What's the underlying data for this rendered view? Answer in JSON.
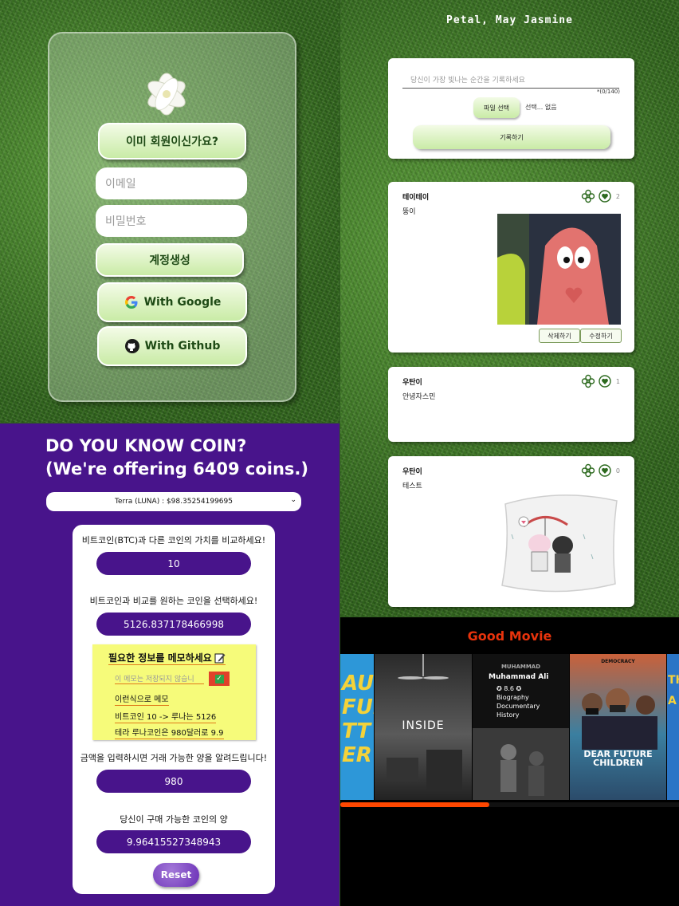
{
  "login": {
    "already_member_label": "이미 회원이신가요?",
    "email_placeholder": "이메일",
    "password_placeholder": "비밀번호",
    "create_account_label": "계정생성",
    "google_label": "With Google",
    "github_label": "With Github"
  },
  "feed": {
    "title": "Petal, May Jasmine",
    "composer": {
      "placeholder": "당신이 가장 빛나는 순간을 기록하세요",
      "char_count": "*(0/140)",
      "file_button": "파일 선택",
      "file_status": "선택... 없음",
      "submit_label": "기록하기"
    },
    "posts": [
      {
        "author": "테이테이",
        "text": "뚱이",
        "count": "2",
        "delete_label": "삭제하기",
        "edit_label": "수정하기"
      },
      {
        "author": "우탄이",
        "text": "안녕자스민",
        "count": "1"
      },
      {
        "author": "우탄이",
        "text": "테스트",
        "count": "0"
      }
    ]
  },
  "coin": {
    "title_line1": "DO YOU KNOW COIN?",
    "title_line2": "(We're offering 6409 coins.)",
    "selected_coin": "Terra (LUNA) : $98.35254199695",
    "compare_label": "비트코인(BTC)과 다른 코인의 가치를 비교하세요!",
    "btc_amount": "10",
    "select_label": "비트코인과 비교를 원하는 코인을 선택하세요!",
    "converted_value": "5126.837178466998",
    "memo": {
      "title": "필요한 정보를 메모하세요",
      "input_placeholder": "이 메모는 저장되지 않습니",
      "items": [
        "이런식으로 메모",
        "비트코인 10 -> 루나는 5126",
        "테라 루나코인은 980달러로 9.9"
      ]
    },
    "amount_label": "금액을 입력하시면 거래 가능한 양을 알려드립니다!",
    "amount_value": "980",
    "buyable_label": "당신이 구매 가능한 코인의 양",
    "buyable_value": "9.96415527348943",
    "reset_label": "Reset"
  },
  "movies": {
    "title": "Good Movie",
    "posters": [
      {
        "lines": [
          "AU",
          "FUL",
          "TT",
          "ER"
        ]
      },
      {
        "lines": [
          "INSIDE"
        ]
      },
      {
        "lines": [
          "MUHAMMAD",
          "Muhammad Ali",
          "✪ 8.6 ✪",
          "Biography",
          "Documentary",
          "History"
        ]
      },
      {
        "lines": [
          "DEMOCRACY",
          "DEAR FUTURE",
          "CHILDREN"
        ]
      },
      {
        "lines": [
          "TH",
          "A"
        ]
      }
    ],
    "scroll_progress": 0.44
  },
  "colors": {
    "coin_purple": "#48148b",
    "movie_accent": "#e8330c",
    "button_green": "#c9eba6"
  }
}
